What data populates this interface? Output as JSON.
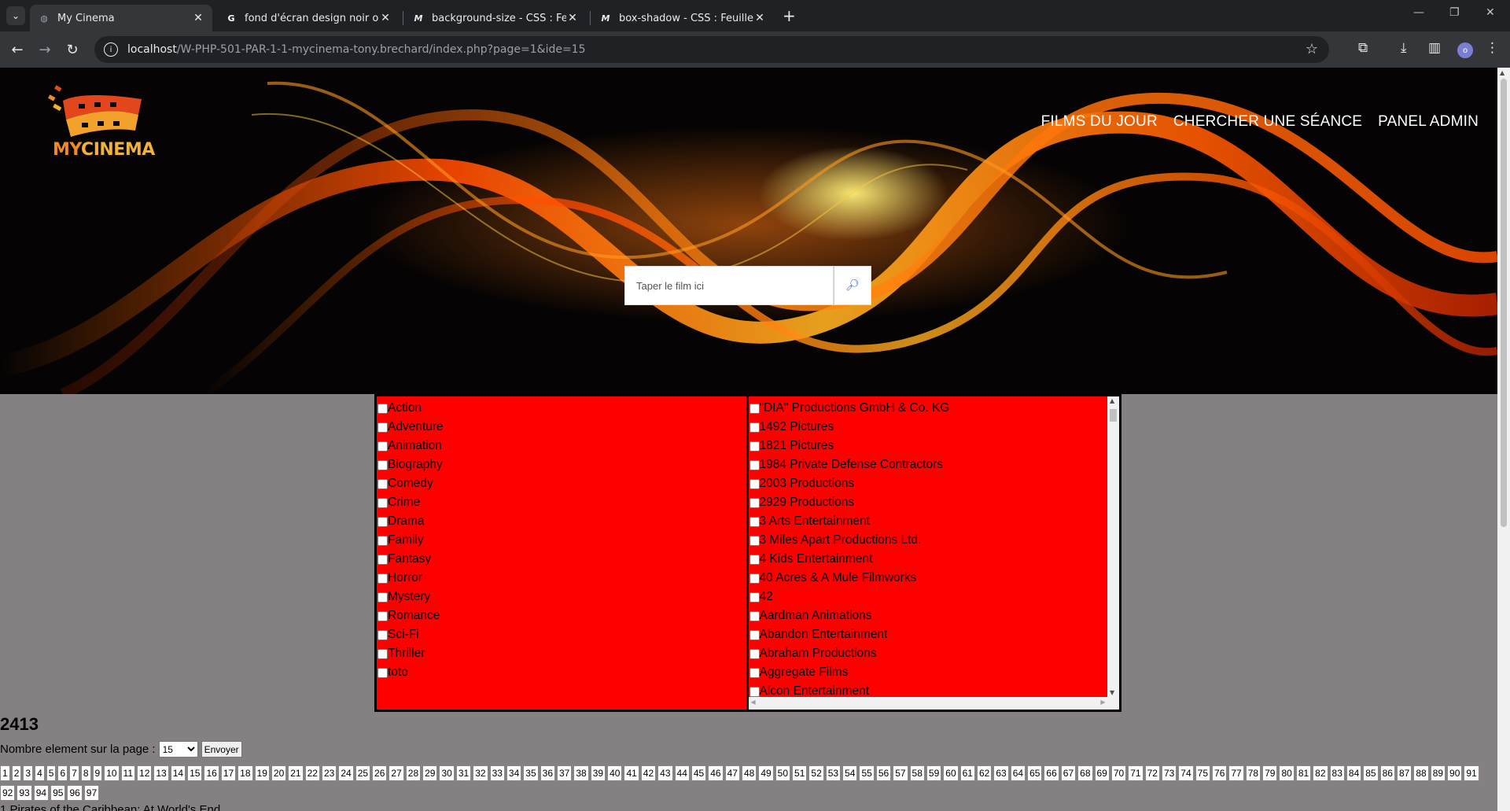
{
  "browser": {
    "tabs": [
      {
        "title": "My Cinema",
        "active": true
      },
      {
        "title": "fond d'écran design noir orang",
        "active": false
      },
      {
        "title": "background-size - CSS : Feuille",
        "active": false
      },
      {
        "title": "box-shadow - CSS : Feuilles de",
        "active": false
      }
    ],
    "url_host": "localhost",
    "url_path": "/W-PHP-501-PAR-1-1-mycinema-tony.brechard/index.php?page=1&ide=15",
    "profile_initial": "o"
  },
  "header": {
    "logo_my": "MY",
    "logo_cinema": "CINEMA",
    "nav": [
      "FILMS DU JOUR",
      "CHERCHER UNE SÉANCE",
      "PANEL ADMIN"
    ]
  },
  "search": {
    "placeholder": "Taper le film ici",
    "button_icon": "search-icon"
  },
  "genres": [
    "Action",
    "Adventure",
    "Animation",
    "Biography",
    "Comedy",
    "Crime",
    "Drama",
    "Family",
    "Fantasy",
    "Horror",
    "Mystery",
    "Romance",
    "Sci-Fi",
    "Thriller",
    "toto"
  ],
  "companies": [
    "\"DIA\" Productions GmbH & Co. KG",
    "1492 Pictures",
    "1821 Pictures",
    "1984 Private Defense Contractors",
    "2003 Productions",
    "2929 Productions",
    "3 Arts Entertainment",
    "3 Miles Apart Productions Ltd.",
    "4 Kids Entertainment",
    "40 Acres & A Mule Filmworks",
    "42",
    "Aardman Animations",
    "Abandon Entertainment",
    "Abraham Productions",
    "Aggregate Films",
    "Alcon Entertainment"
  ],
  "results": {
    "count": "2413",
    "per_page_label": "Nombre element sur la page :",
    "per_page_value": "15",
    "submit_label": "Envoyer",
    "pages": [
      "1",
      "2",
      "3",
      "4",
      "5",
      "6",
      "7",
      "8",
      "9",
      "10",
      "11",
      "12",
      "13",
      "14",
      "15",
      "16",
      "17",
      "18",
      "19",
      "20",
      "21",
      "22",
      "23",
      "24",
      "25",
      "26",
      "27",
      "28",
      "29",
      "30",
      "31",
      "32",
      "33",
      "34",
      "35",
      "36",
      "37",
      "38",
      "39",
      "40",
      "41",
      "42",
      "43",
      "44",
      "45",
      "46",
      "47",
      "48",
      "49",
      "50",
      "51",
      "52",
      "53",
      "54",
      "55",
      "56",
      "57",
      "58",
      "59",
      "60",
      "61",
      "62",
      "63",
      "64",
      "65",
      "66",
      "67",
      "68",
      "69",
      "70",
      "71",
      "72",
      "73",
      "74",
      "75",
      "76",
      "77",
      "78",
      "79",
      "80",
      "81",
      "82",
      "83",
      "84",
      "85",
      "86",
      "87",
      "88",
      "89",
      "90",
      "91",
      "92",
      "93",
      "94",
      "95",
      "96",
      "97"
    ],
    "first_film": "1 Pirates of the Caribbean: At World's End"
  }
}
